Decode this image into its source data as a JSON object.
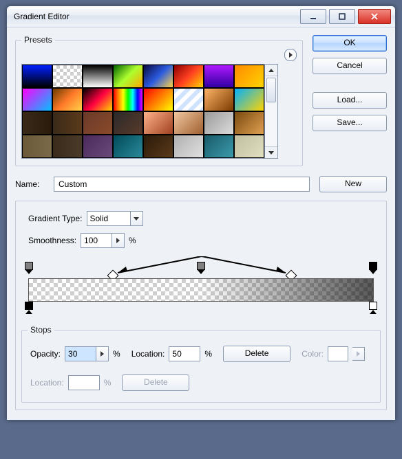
{
  "window": {
    "title": "Gradient Editor"
  },
  "buttons": {
    "ok": "OK",
    "cancel": "Cancel",
    "load": "Load...",
    "save": "Save...",
    "new": "New",
    "delete": "Delete"
  },
  "presets": {
    "legend": "Presets"
  },
  "name": {
    "label": "Name:",
    "value": "Custom"
  },
  "gradient_type": {
    "label": "Gradient Type:",
    "value": "Solid"
  },
  "smoothness": {
    "label": "Smoothness:",
    "value": "100",
    "unit": "%"
  },
  "stops": {
    "legend": "Stops",
    "opacity": {
      "label": "Opacity:",
      "value": "30",
      "unit": "%"
    },
    "location1": {
      "label": "Location:",
      "value": "50",
      "unit": "%"
    },
    "color": {
      "label": "Color:"
    },
    "location2": {
      "label": "Location:",
      "unit": "%"
    }
  },
  "swatches": [
    "linear-gradient(#0020ff,#000)",
    "repeating-conic-gradient(#cfcfcf 0 25%,#fff 0 50%) 0 0/10px 10px",
    "linear-gradient(#000,#fff)",
    "linear-gradient(135deg,#006400,#adff2f,#ffa500)",
    "linear-gradient(135deg,#0a0a40,#2a5adf,#ffd54a)",
    "linear-gradient(135deg,#8b0000,#ff4020,#ffd400)",
    "linear-gradient(#b019ff,#3000a0)",
    "linear-gradient(135deg,#ff8a00,#ffd400)",
    "linear-gradient(135deg,#ff00ff,#00c0ff)",
    "linear-gradient(135deg,#6a3a00,#ff7a29,#ffd34a)",
    "linear-gradient(135deg,#000,#ff0040,#ffd400)",
    "linear-gradient(90deg,#f00,#ff8800,#ff0,#0f0,#0ff,#00f,#f0f)",
    "linear-gradient(135deg,#f00,#ff0)",
    "repeating-linear-gradient(135deg,#cfe3ff 0 6px,#fff 6px 12px)",
    "linear-gradient(135deg,#ffb366,#7a3a00)",
    "linear-gradient(135deg,#00b0ff,#ffd400)",
    "linear-gradient(90deg,#3a2a1a,#2a1a0a)",
    "linear-gradient(90deg,#3a2a1a,#5a3a1a)",
    "linear-gradient(135deg,#6a3a2a,#8a4a2a)",
    "linear-gradient(135deg,#2a2a2a,#5a3a2a)",
    "linear-gradient(135deg,#ffb38a,#a04020)",
    "linear-gradient(135deg,#f0c6a0,#a06030)",
    "linear-gradient(135deg,#9a9a9a,#dcdcdc)",
    "linear-gradient(135deg,#7a4a10,#e0a050)",
    "linear-gradient(90deg,#6a5a3a,#7a6a4a)",
    "linear-gradient(90deg,#3a2a1a,#4a3a2a)",
    "linear-gradient(135deg,#4a2a5a,#6a4a7a)",
    "linear-gradient(135deg,#004a5a,#2a8a9a)",
    "linear-gradient(135deg,#2a1a0a,#5a3a1a)",
    "linear-gradient(135deg,#b0b0b0,#e0e0e0)",
    "linear-gradient(135deg,#1a5a6a,#3a9aaa)",
    "linear-gradient(135deg,#c0c0a0,#e0e0c0)"
  ]
}
